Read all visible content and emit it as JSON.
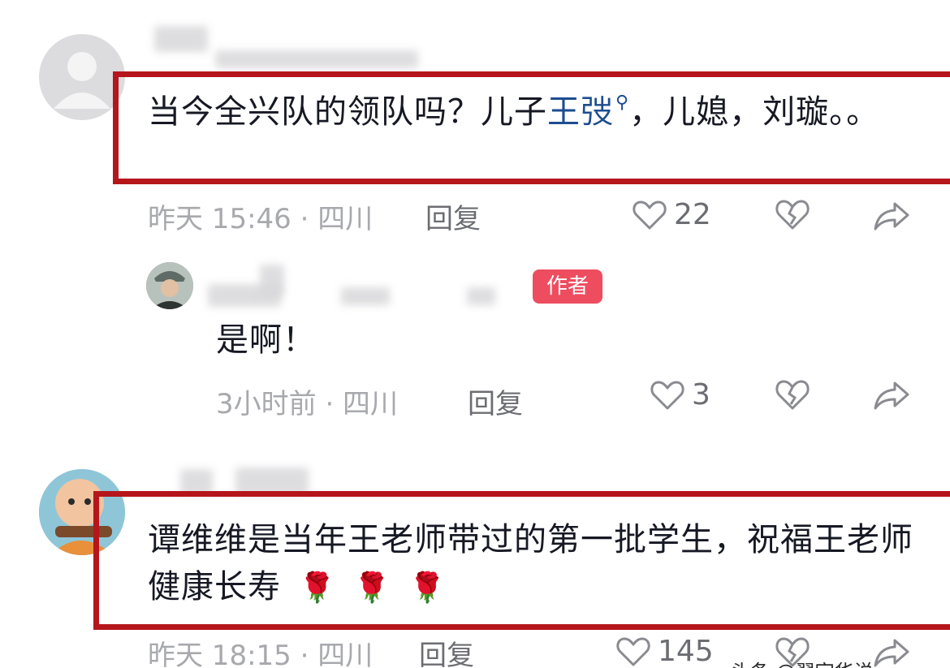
{
  "comments": [
    {
      "text_before": "当今全兴队的领队吗？儿子",
      "search_term": "王弢",
      "text_after": "，儿媳，刘璇。。",
      "meta": "昨天 15:46 · 四川",
      "reply_label": "回复",
      "likes": "22"
    },
    {
      "author_badge": "作者",
      "text": "是啊！",
      "meta": "3小时前 · 四川",
      "reply_label": "回复",
      "likes": "3"
    },
    {
      "text": "谭维维是当年王老师带过的第一批学生，祝福王老师健康长寿",
      "roses": [
        "🌹",
        "🌹",
        "🌹"
      ],
      "meta": "昨天 18:15 · 四川",
      "reply_label": "回复",
      "likes": "145"
    }
  ],
  "icons": {
    "like": "heart-outline-icon",
    "dislike": "broken-heart-icon",
    "share": "share-arrow-icon",
    "search": "search-icon"
  },
  "colors": {
    "highlight": "#b5161b",
    "badge": "#ee4d60",
    "link": "#1d4d8f",
    "muted": "#a8a9ad"
  },
  "watermark": "头条 @翟宇华说"
}
